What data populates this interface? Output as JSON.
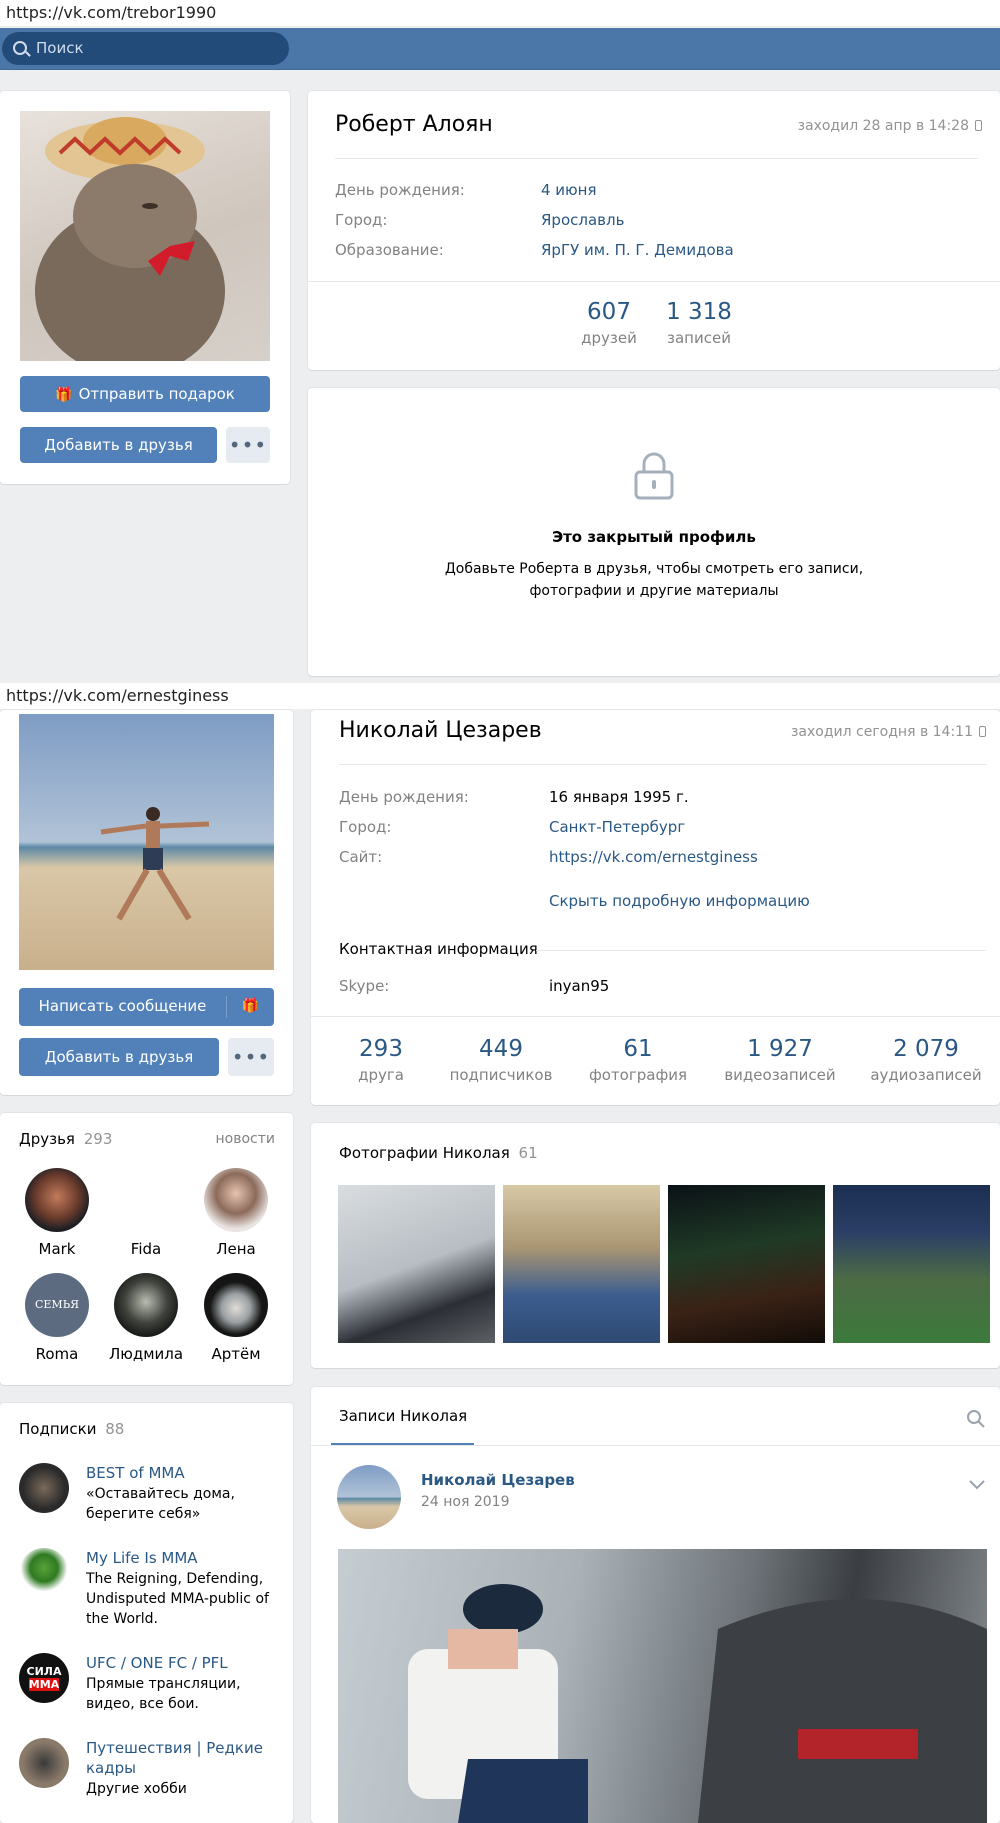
{
  "profile1": {
    "url": "https://vk.com/trebor1990",
    "search_placeholder": "Поиск",
    "name": "Роберт Алоян",
    "online": "заходил 28 апр в 14:28",
    "info": [
      {
        "label": "День рождения:",
        "value": "4 июня"
      },
      {
        "label": "Город:",
        "value": "Ярославль"
      },
      {
        "label": "Образование:",
        "value": "ЯрГУ им. П. Г. Демидова"
      }
    ],
    "counters": [
      {
        "num": "607",
        "label": "друзей"
      },
      {
        "num": "1 318",
        "label": "записей"
      }
    ],
    "gift_button": "Отправить подарок",
    "add_friend_button": "Добавить в друзья",
    "more_button": "•••",
    "closed_title": "Это закрытый профиль",
    "closed_text_1": "Добавьте Роберта в друзья, чтобы смотреть его записи,",
    "closed_text_2": "фотографии и другие материалы"
  },
  "profile2": {
    "url": "https://vk.com/ernestginess",
    "name": "Николай Цезарев",
    "online": "заходил сегодня в 14:11",
    "info": [
      {
        "label": "День рождения:",
        "value": "16 января 1995 г."
      },
      {
        "label": "Город:",
        "value": "Санкт-Петербург"
      },
      {
        "label": "Сайт:",
        "value": "https://vk.com/ernestginess"
      }
    ],
    "hide_info_link": "Скрыть подробную информацию",
    "contacts_title": "Контактная информация",
    "skype_label": "Skype:",
    "skype_value": "inyan95",
    "counters": [
      {
        "num": "293",
        "label": "друга"
      },
      {
        "num": "449",
        "label": "подписчиков"
      },
      {
        "num": "61",
        "label": "фотография"
      },
      {
        "num": "1 927",
        "label": "видеозаписей"
      },
      {
        "num": "2 079",
        "label": "аудиозаписей"
      }
    ],
    "message_button": "Написать сообщение",
    "add_friend_button": "Добавить в друзья",
    "more_button": "•••",
    "friends_title": "Друзья",
    "friends_count": "293",
    "news_link": "новости",
    "friends": [
      "Mark",
      "Fida",
      "Лена",
      "Roma",
      "Людмила",
      "Артём"
    ],
    "photos_title": "Фотографии Николая",
    "photos_count": "61",
    "subs_title": "Подписки",
    "subs_count": "88",
    "subs": [
      {
        "title": "BEST of MMA",
        "desc": "«Оставайтесь дома, берегите себя»"
      },
      {
        "title": "My Life Is MMA",
        "desc": "The Reigning, Defending, Undisputed MMA-public of the World."
      },
      {
        "title": "UFC / ONE FC / PFL",
        "desc": "Прямые трансляции, видео, все бои."
      },
      {
        "title": "Путешествия | Редкие кадры",
        "desc": "Другие хобби"
      }
    ],
    "wall_tab": "Записи Николая",
    "post_author": "Николай Цезарев",
    "post_date": "24 ноя 2019",
    "logo_sila_1": "СИЛА",
    "logo_sila_2": "ММА",
    "logo_seven": "СЕМЬЯ"
  },
  "colors": {
    "accent": "#5181b8",
    "header": "#4a76a8",
    "link": "#2a5885",
    "bg": "#edeef0"
  }
}
